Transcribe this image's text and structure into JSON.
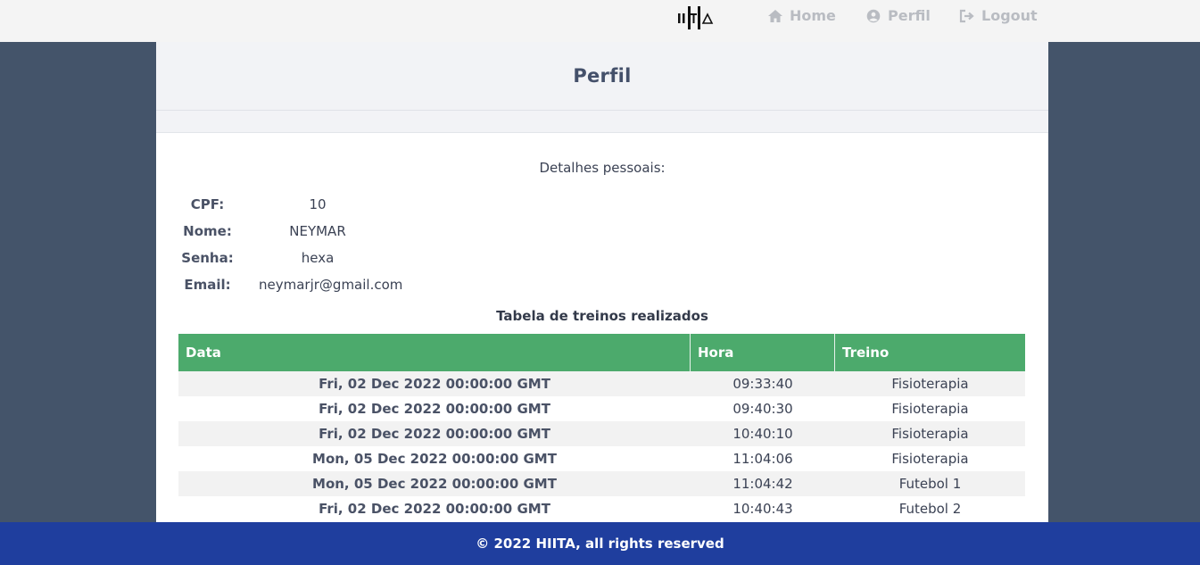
{
  "nav": {
    "logo_alt": "HIITA",
    "items": [
      {
        "label": "Home",
        "icon": "home-icon"
      },
      {
        "label": "Perfil",
        "icon": "user-circle-icon"
      },
      {
        "label": "Logout",
        "icon": "sign-out-icon"
      }
    ]
  },
  "page": {
    "title": "Perfil",
    "details_title": "Detalhes pessoais:",
    "details": [
      {
        "label": "CPF:",
        "value": "10"
      },
      {
        "label": "Nome:",
        "value": "NEYMAR"
      },
      {
        "label": "Senha:",
        "value": "hexa"
      },
      {
        "label": "Email:",
        "value": "neymarjr@gmail.com"
      }
    ]
  },
  "table": {
    "title": "Tabela de treinos realizados",
    "headers": [
      "Data",
      "Hora",
      "Treino"
    ],
    "rows": [
      [
        "Fri, 02 Dec 2022 00:00:00 GMT",
        "09:33:40",
        "Fisioterapia"
      ],
      [
        "Fri, 02 Dec 2022 00:00:00 GMT",
        "09:40:30",
        "Fisioterapia"
      ],
      [
        "Fri, 02 Dec 2022 00:00:00 GMT",
        "10:40:10",
        "Fisioterapia"
      ],
      [
        "Mon, 05 Dec 2022 00:00:00 GMT",
        "11:04:06",
        "Fisioterapia"
      ],
      [
        "Mon, 05 Dec 2022 00:00:00 GMT",
        "11:04:42",
        "Futebol 1"
      ],
      [
        "Fri, 02 Dec 2022 00:00:00 GMT",
        "10:40:43",
        "Futebol 2"
      ]
    ]
  },
  "footer": {
    "text": "© 2022 HIITA, all rights reserved"
  },
  "colors": {
    "background": "#44546a",
    "topbar": "#f4f4f4",
    "nav_text": "#b9bcc2",
    "table_header": "#4caa6c",
    "footer": "#1f3e9e"
  }
}
